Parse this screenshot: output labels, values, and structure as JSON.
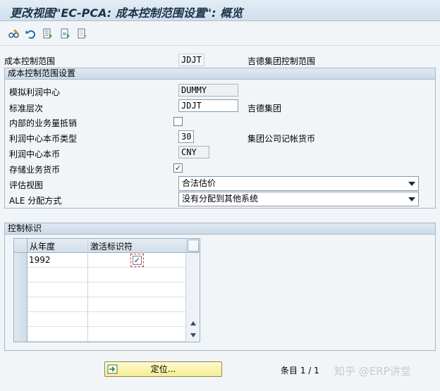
{
  "title": "更改视图\"EC-PCA: 成本控制范围设置\": 概览",
  "toolbar": {
    "icons": [
      "glasses-change-icon",
      "undo-icon",
      "select-all-icon",
      "select-block-icon",
      "deselect-all-icon"
    ]
  },
  "controlling_area": {
    "label": "成本控制范围",
    "value": "JDJT",
    "desc": "吉德集团控制范围"
  },
  "settings": {
    "header": "成本控制范围设置",
    "dummy_label": "模拟利润中心",
    "dummy_value": "DUMMY",
    "std_label": "标准层次",
    "std_value": "JDJT",
    "std_desc": "吉德集团",
    "internal_label": "内部的业务量抵销",
    "internal_checked": false,
    "pc_currtype_label": "利润中心本币类型",
    "pc_currtype_value": "30",
    "pc_currtype_desc": "集团公司记帐货币",
    "pc_curr_label": "利润中心本币",
    "pc_curr_value": "CNY",
    "store_label": "存储业务货币",
    "store_checked": true,
    "valuation_label": "评估视图",
    "valuation_value": "合法估价",
    "ale_label": "ALE 分配方式",
    "ale_value": "没有分配到其他系统"
  },
  "control": {
    "header": "控制标识",
    "col_year": "从年度",
    "col_active": "激活标识符",
    "rows": [
      {
        "year": "1992",
        "active": true
      }
    ]
  },
  "button": {
    "label": "定位..."
  },
  "entry": "条目 1 / 1",
  "watermark": "知乎 @ERP讲堂",
  "colors": {
    "accent": "#1c3248",
    "button_bg": "#f6ec92"
  }
}
